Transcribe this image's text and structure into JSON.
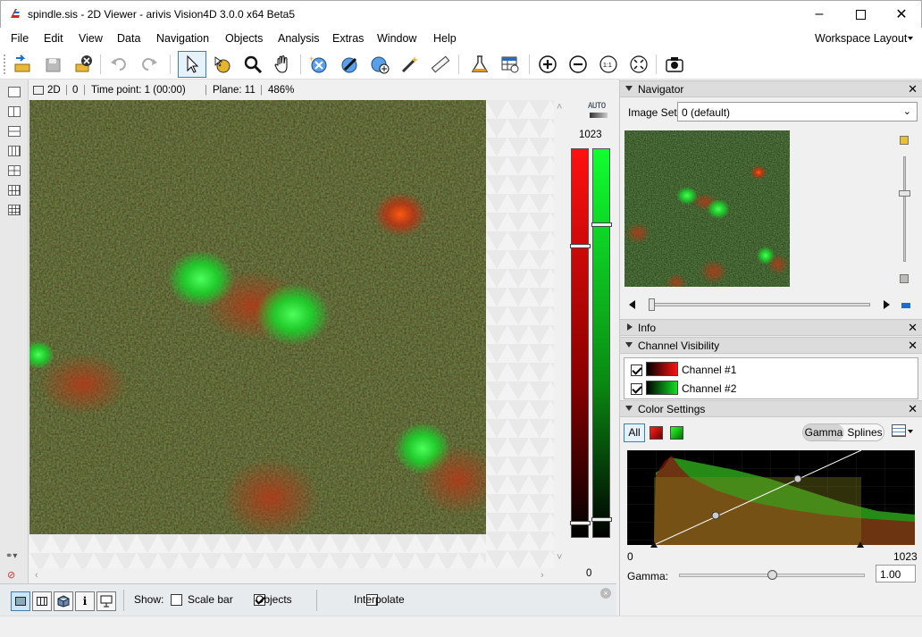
{
  "window": {
    "title": "spindle.sis - 2D Viewer - arivis Vision4D 3.0.0 x64 Beta5"
  },
  "menu": [
    "File",
    "Edit",
    "View",
    "Data",
    "Navigation",
    "Objects",
    "Analysis",
    "Extras",
    "Window",
    "Help"
  ],
  "workspace_layout": "Workspace Layout",
  "viewer": {
    "mode": "2D",
    "index": "0",
    "time_point": "Time point: 1 (00:00)",
    "plane": "Plane: 11",
    "zoom": "486%"
  },
  "lut": {
    "auto": "AUTO",
    "max": "1023",
    "min": "0"
  },
  "bottom": {
    "show_label": "Show:",
    "scale_bar": "Scale bar",
    "objects": "Objects",
    "interpolate": "Interpolate",
    "scale_bar_checked": false,
    "objects_checked": true,
    "interpolate_checked": false
  },
  "navigator": {
    "title": "Navigator",
    "image_set_label": "Image Set:",
    "image_set_value": "0 (default)"
  },
  "info": {
    "title": "Info"
  },
  "channel_visibility": {
    "title": "Channel Visibility",
    "channels": [
      {
        "name": "Channel #1",
        "color": "#e00000"
      },
      {
        "name": "Channel #2",
        "color": "#00d000"
      }
    ]
  },
  "color_settings": {
    "title": "Color Settings",
    "all": "All",
    "gamma_tab": "Gamma",
    "splines_tab": "Splines",
    "axis_min": "0",
    "axis_max": "1023",
    "gamma_label": "Gamma:",
    "gamma_value": "1.00"
  },
  "colors": {
    "accent": "#3c7fb1",
    "red_channel": "#e00000",
    "green_channel": "#00d000"
  }
}
